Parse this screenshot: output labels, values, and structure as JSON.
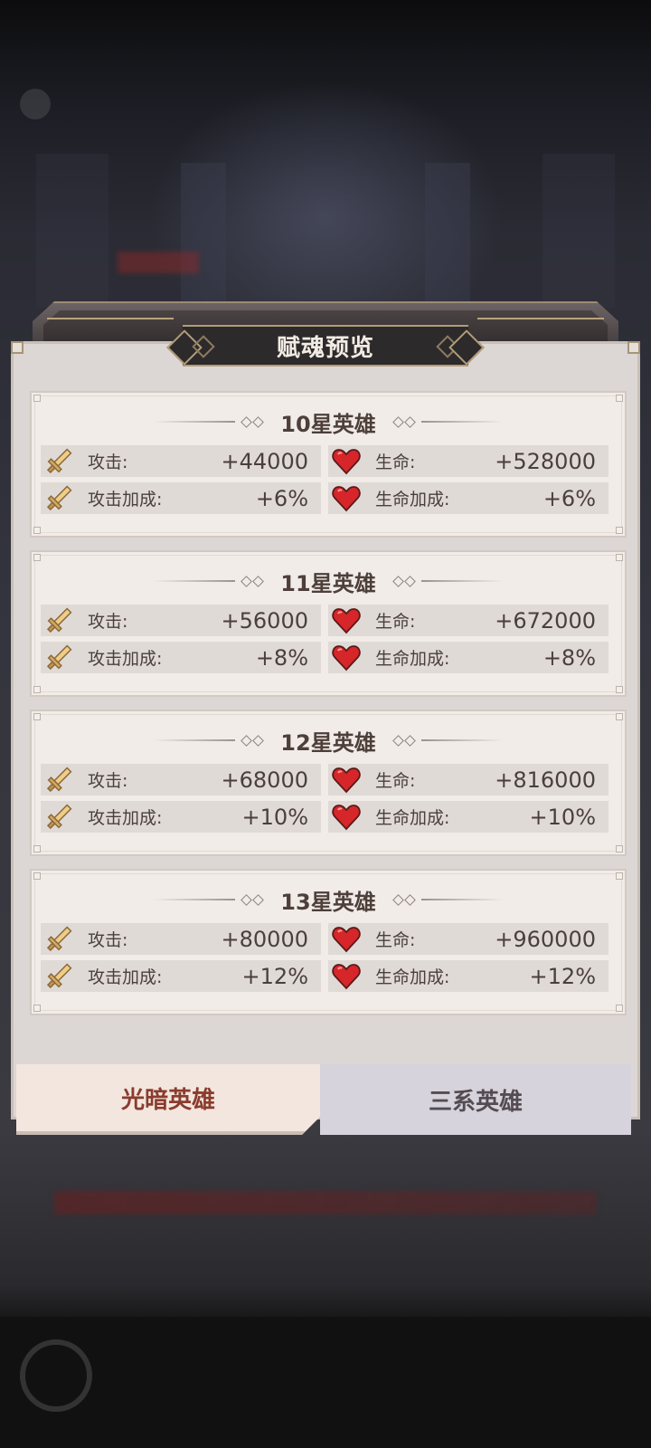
{
  "modal": {
    "title": "赋魂预览"
  },
  "cards": [
    {
      "title": "10星英雄",
      "stats": [
        {
          "icon": "sword-icon",
          "label": "攻击:",
          "value": "+44000"
        },
        {
          "icon": "heart-icon",
          "label": "生命:",
          "value": "+528000"
        },
        {
          "icon": "sword-icon",
          "label": "攻击加成:",
          "value": "+6%"
        },
        {
          "icon": "heart-icon",
          "label": "生命加成:",
          "value": "+6%"
        }
      ]
    },
    {
      "title": "11星英雄",
      "stats": [
        {
          "icon": "sword-icon",
          "label": "攻击:",
          "value": "+56000"
        },
        {
          "icon": "heart-icon",
          "label": "生命:",
          "value": "+672000"
        },
        {
          "icon": "sword-icon",
          "label": "攻击加成:",
          "value": "+8%"
        },
        {
          "icon": "heart-icon",
          "label": "生命加成:",
          "value": "+8%"
        }
      ]
    },
    {
      "title": "12星英雄",
      "stats": [
        {
          "icon": "sword-icon",
          "label": "攻击:",
          "value": "+68000"
        },
        {
          "icon": "heart-icon",
          "label": "生命:",
          "value": "+816000"
        },
        {
          "icon": "sword-icon",
          "label": "攻击加成:",
          "value": "+10%"
        },
        {
          "icon": "heart-icon",
          "label": "生命加成:",
          "value": "+10%"
        }
      ]
    },
    {
      "title": "13星英雄",
      "stats": [
        {
          "icon": "sword-icon",
          "label": "攻击:",
          "value": "+80000"
        },
        {
          "icon": "heart-icon",
          "label": "生命:",
          "value": "+960000"
        },
        {
          "icon": "sword-icon",
          "label": "攻击加成:",
          "value": "+12%"
        },
        {
          "icon": "heart-icon",
          "label": "生命加成:",
          "value": "+12%"
        }
      ]
    }
  ],
  "tabs": [
    {
      "label": "光暗英雄",
      "active": true
    },
    {
      "label": "三系英雄",
      "active": false
    }
  ],
  "colors": {
    "active_tab_text": "#8a3c2e",
    "inactive_tab_text": "#544c52",
    "stat_text": "#4a3f3b",
    "heart_red": "#d6262a",
    "sword_gold": "#e6c07a"
  }
}
